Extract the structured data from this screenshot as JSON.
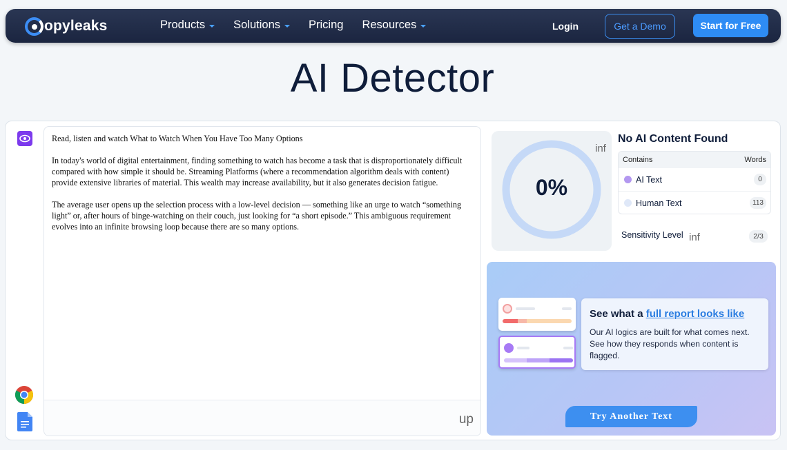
{
  "nav": {
    "logo_text": "opyleaks",
    "menu": [
      {
        "label": "Products",
        "dropdown": true
      },
      {
        "label": "Solutions",
        "dropdown": true
      },
      {
        "label": "Pricing",
        "dropdown": false
      },
      {
        "label": "Resources",
        "dropdown": true
      }
    ],
    "login": "Login",
    "demo": "Get a Demo",
    "start": "Start for Free"
  },
  "page_title": "AI Detector",
  "editor": {
    "paragraphs": [
      "Read, listen and watch What to Watch When You Have Too Many Options",
      "In today's world of digital entertainment, finding something to watch has become a task that is disproportionately difficult compared with how simple it should be. Streaming Platforms (where a recommendation algorithm deals with content) provide extensive libraries of material. This wealth may increase availability, but it also generates decision fatigue.",
      "The average user opens up the selection process with a low-level decision — something like an urge to watch “something light” or, after hours of binge-watching on their couch, just looking for “a short episode.” This ambiguous requirement evolves into an infinite browsing loop because there are so many options."
    ],
    "upload_label": "up"
  },
  "results": {
    "percent": "0%",
    "ai_fraction": 0,
    "gauge_inf": "inf",
    "title": "No AI Content Found",
    "table_header": {
      "contains": "Contains",
      "words": "Words"
    },
    "rows": [
      {
        "label": "AI Text",
        "count": "0",
        "color": "#b398f0"
      },
      {
        "label": "Human Text",
        "count": "113",
        "color": "#dfe8f8"
      }
    ],
    "sensitivity_label": "Sensitivity Level",
    "sensitivity_inf": "inf",
    "sensitivity_value": "2/3"
  },
  "promo": {
    "heading_prefix": "See what a ",
    "heading_link": "full report looks like",
    "description": "Our AI logics are built for what comes next. See how they responds when content is flagged.",
    "try_button": "Try Another Text"
  },
  "colors": {
    "accent": "#2e8cf5",
    "nav_bg": "#1f2a45",
    "gauge_ring": "#c5d9f7",
    "ai_purple": "#7c3aed"
  }
}
